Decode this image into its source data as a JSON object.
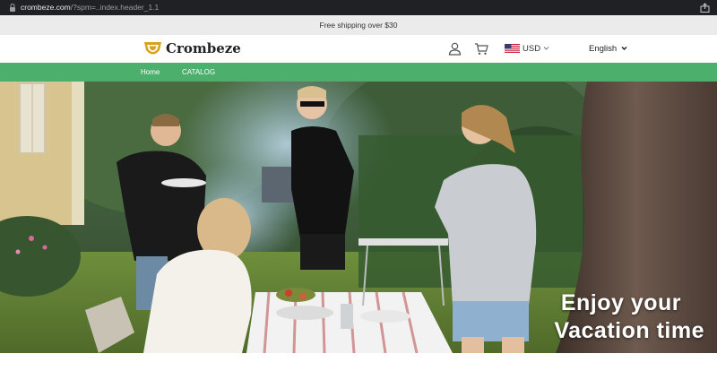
{
  "browser": {
    "url_domain": "crombeze.com",
    "url_path": "/?spm=..index.header_1.1"
  },
  "announcement": "Free shipping over $30",
  "header": {
    "logo_text": "Crombeze",
    "currency": "USD",
    "language": "English"
  },
  "nav": {
    "items": [
      {
        "label": "Home"
      },
      {
        "label": "CATALOG"
      }
    ]
  },
  "hero": {
    "line1": "Enjoy your",
    "line2": "Vacation time"
  },
  "colors": {
    "nav_green": "#4caf6b",
    "announcement_bg": "#ebebeb"
  }
}
